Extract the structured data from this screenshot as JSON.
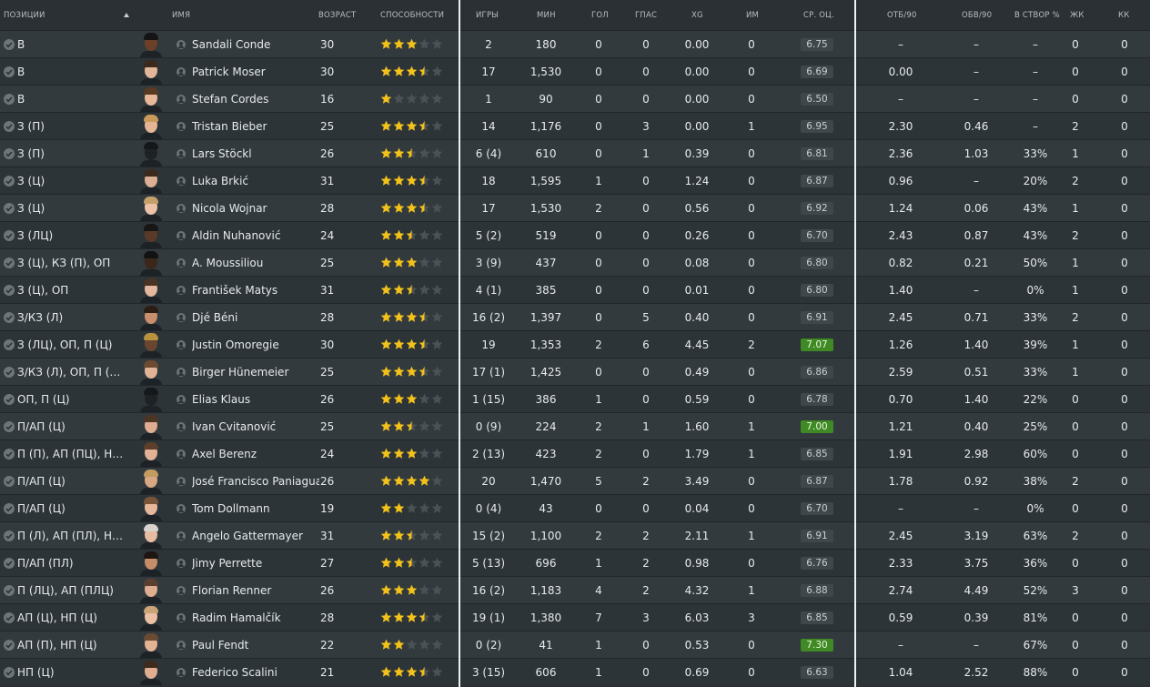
{
  "columns": {
    "positions": "ПОЗИЦИИ",
    "name": "ИМЯ",
    "age": "ВОЗРАСТ",
    "ability": "СПОСОБНОСТИ",
    "games": "ИГРЫ",
    "minutes": "МИН",
    "goals": "ГОЛ",
    "assists": "ГПАС",
    "xg": "XG",
    "mom": "ИМ",
    "avg_rating": "СР. ОЦ.",
    "tackles90": "ОТБ/90",
    "dribbles90": "ОБВ/90",
    "shots_on_target": "В СТВОР %",
    "yellow": "ЖК",
    "red": "КК"
  },
  "colors": {
    "star_gold": "#f2c21b",
    "star_empty": "#4a5256",
    "rating_high": "#3f8a24",
    "rating_default": "#3f474b"
  },
  "players": [
    {
      "pos": "В",
      "name": "Sandali Conde",
      "age": "30",
      "stars": 3,
      "games": "2",
      "min": "180",
      "goals": "0",
      "ast": "0",
      "xg": "0.00",
      "mom": "0",
      "rating": "6.75",
      "hi": false,
      "tck": "–",
      "drb": "–",
      "sot": "–",
      "yc": "0",
      "rc": "0",
      "skin": "#6b4026",
      "hair": "#141414"
    },
    {
      "pos": "В",
      "name": "Patrick Moser",
      "age": "30",
      "stars": 3.5,
      "games": "17",
      "min": "1,530",
      "goals": "0",
      "ast": "0",
      "xg": "0.00",
      "mom": "0",
      "rating": "6.69",
      "hi": false,
      "tck": "0.00",
      "drb": "–",
      "sot": "–",
      "yc": "0",
      "rc": "0",
      "skin": "#e3b69a",
      "hair": "#3a2a1e"
    },
    {
      "pos": "В",
      "name": "Stefan Cordes",
      "age": "16",
      "stars": 1,
      "games": "1",
      "min": "90",
      "goals": "0",
      "ast": "0",
      "xg": "0.00",
      "mom": "0",
      "rating": "6.50",
      "hi": false,
      "tck": "–",
      "drb": "–",
      "sot": "–",
      "yc": "0",
      "rc": "0",
      "skin": "#e8b899",
      "hair": "#5a3b22"
    },
    {
      "pos": "З (П)",
      "name": "Tristan Bieber",
      "age": "25",
      "stars": 3.5,
      "games": "14",
      "min": "1,176",
      "goals": "0",
      "ast": "3",
      "xg": "0.00",
      "mom": "1",
      "rating": "6.95",
      "hi": false,
      "tck": "2.30",
      "drb": "0.46",
      "sot": "–",
      "yc": "2",
      "rc": "0",
      "skin": "#e6b596",
      "hair": "#c99a5a"
    },
    {
      "pos": "З (П)",
      "name": "Lars Stöckl",
      "age": "26",
      "stars": 2.5,
      "games": "6 (4)",
      "min": "610",
      "goals": "0",
      "ast": "1",
      "xg": "0.39",
      "mom": "0",
      "rating": "6.81",
      "hi": false,
      "tck": "2.36",
      "drb": "1.03",
      "sot": "33%",
      "yc": "1",
      "rc": "0",
      "skin": "#1e2225",
      "hair": "#15181a"
    },
    {
      "pos": "З (Ц)",
      "name": "Luka Brkić",
      "age": "31",
      "stars": 3.5,
      "games": "18",
      "min": "1,595",
      "goals": "1",
      "ast": "0",
      "xg": "1.24",
      "mom": "0",
      "rating": "6.87",
      "hi": false,
      "tck": "0.96",
      "drb": "–",
      "sot": "20%",
      "yc": "2",
      "rc": "0",
      "skin": "#dcae94",
      "hair": "#3b2a1e"
    },
    {
      "pos": "З (Ц)",
      "name": "Nicola Wojnar",
      "age": "28",
      "stars": 3.5,
      "games": "17",
      "min": "1,530",
      "goals": "2",
      "ast": "0",
      "xg": "0.56",
      "mom": "0",
      "rating": "6.92",
      "hi": false,
      "tck": "1.24",
      "drb": "0.06",
      "sot": "43%",
      "yc": "1",
      "rc": "0",
      "skin": "#ecc3a6",
      "hair": "#c4a06a"
    },
    {
      "pos": "З (ЛЦ)",
      "name": "Aldin Nuhanović",
      "age": "24",
      "stars": 2.5,
      "games": "5 (2)",
      "min": "519",
      "goals": "0",
      "ast": "0",
      "xg": "0.26",
      "mom": "0",
      "rating": "6.70",
      "hi": false,
      "tck": "2.43",
      "drb": "0.87",
      "sot": "43%",
      "yc": "2",
      "rc": "0",
      "skin": "#5a3a26",
      "hair": "#161616"
    },
    {
      "pos": "З (Ц), КЗ (П), ОП",
      "name": "A. Moussiliou",
      "age": "25",
      "stars": 3,
      "games": "3 (9)",
      "min": "437",
      "goals": "0",
      "ast": "0",
      "xg": "0.08",
      "mom": "0",
      "rating": "6.80",
      "hi": false,
      "tck": "0.82",
      "drb": "0.21",
      "sot": "50%",
      "yc": "1",
      "rc": "0",
      "skin": "#3b261a",
      "hair": "#121212"
    },
    {
      "pos": "З (Ц), ОП",
      "name": "František Matys",
      "age": "31",
      "stars": 2.5,
      "games": "4 (1)",
      "min": "385",
      "goals": "0",
      "ast": "0",
      "xg": "0.01",
      "mom": "0",
      "rating": "6.80",
      "hi": false,
      "tck": "1.40",
      "drb": "–",
      "sot": "0%",
      "yc": "1",
      "rc": "0",
      "skin": "#e4b89e",
      "hair": "#4a3322"
    },
    {
      "pos": "З/КЗ (Л)",
      "name": "Djé Béni",
      "age": "28",
      "stars": 3.5,
      "games": "16 (2)",
      "min": "1,397",
      "goals": "0",
      "ast": "5",
      "xg": "0.40",
      "mom": "0",
      "rating": "6.91",
      "hi": false,
      "tck": "2.45",
      "drb": "0.71",
      "sot": "33%",
      "yc": "2",
      "rc": "0",
      "skin": "#c98e6c",
      "hair": "#2b1d14"
    },
    {
      "pos": "З (ЛЦ), ОП, П (Ц)",
      "name": "Justin Omoregie",
      "age": "30",
      "stars": 3.5,
      "games": "19",
      "min": "1,353",
      "goals": "2",
      "ast": "6",
      "xg": "4.45",
      "mom": "2",
      "rating": "7.07",
      "hi": true,
      "tck": "1.26",
      "drb": "1.40",
      "sot": "39%",
      "yc": "1",
      "rc": "0",
      "skin": "#6a4630",
      "hair": "#b8923c"
    },
    {
      "pos": "З/КЗ (Л), ОП, П (Ц), А...",
      "name": "Birger Hünemeier",
      "age": "25",
      "stars": 3.5,
      "games": "17 (1)",
      "min": "1,425",
      "goals": "0",
      "ast": "0",
      "xg": "0.49",
      "mom": "0",
      "rating": "6.86",
      "hi": false,
      "tck": "2.59",
      "drb": "0.51",
      "sot": "33%",
      "yc": "1",
      "rc": "0",
      "skin": "#e2b397",
      "hair": "#6b4a30"
    },
    {
      "pos": "ОП, П (Ц)",
      "name": "Elias Klaus",
      "age": "26",
      "stars": 3,
      "games": "1 (15)",
      "min": "386",
      "goals": "1",
      "ast": "0",
      "xg": "0.59",
      "mom": "0",
      "rating": "6.78",
      "hi": false,
      "tck": "0.70",
      "drb": "1.40",
      "sot": "22%",
      "yc": "0",
      "rc": "0",
      "skin": "#1e2225",
      "hair": "#15181a"
    },
    {
      "pos": "П/АП (Ц)",
      "name": "Ivan Cvitanović",
      "age": "25",
      "stars": 2.5,
      "games": "0 (9)",
      "min": "224",
      "goals": "2",
      "ast": "1",
      "xg": "1.60",
      "mom": "1",
      "rating": "7.00",
      "hi": true,
      "tck": "1.21",
      "drb": "0.40",
      "sot": "25%",
      "yc": "0",
      "rc": "0",
      "skin": "#dfae92",
      "hair": "#4d3526"
    },
    {
      "pos": "П (П), АП (ПЦ), НП (Ц)",
      "name": "Axel Berenz",
      "age": "24",
      "stars": 3,
      "games": "2 (13)",
      "min": "423",
      "goals": "2",
      "ast": "0",
      "xg": "1.79",
      "mom": "1",
      "rating": "6.85",
      "hi": false,
      "tck": "1.91",
      "drb": "2.98",
      "sot": "60%",
      "yc": "0",
      "rc": "0",
      "skin": "#e2b196",
      "hair": "#5b3f2a"
    },
    {
      "pos": "П/АП (Ц)",
      "name": "José Francisco Paniagua",
      "age": "26",
      "stars": 4,
      "games": "20",
      "min": "1,470",
      "goals": "5",
      "ast": "2",
      "xg": "3.49",
      "mom": "0",
      "rating": "6.87",
      "hi": false,
      "tck": "1.78",
      "drb": "0.92",
      "sot": "38%",
      "yc": "2",
      "rc": "0",
      "skin": "#d8a884",
      "hair": "#c29a62"
    },
    {
      "pos": "П/АП (Ц)",
      "name": "Tom Dollmann",
      "age": "19",
      "stars": 2,
      "games": "0 (4)",
      "min": "43",
      "goals": "0",
      "ast": "0",
      "xg": "0.04",
      "mom": "0",
      "rating": "6.70",
      "hi": false,
      "tck": "–",
      "drb": "–",
      "sot": "0%",
      "yc": "0",
      "rc": "0",
      "skin": "#e6b79a",
      "hair": "#7a5436"
    },
    {
      "pos": "П (Л), АП (ПЛ), НП (Ц)",
      "name": "Angelo Gattermayer",
      "age": "31",
      "stars": 2.5,
      "games": "15 (2)",
      "min": "1,100",
      "goals": "2",
      "ast": "2",
      "xg": "2.11",
      "mom": "1",
      "rating": "6.91",
      "hi": false,
      "tck": "2.45",
      "drb": "3.19",
      "sot": "63%",
      "yc": "2",
      "rc": "0",
      "skin": "#e8bca2",
      "hair": "#d9d2cc"
    },
    {
      "pos": "П/АП (ПЛ)",
      "name": "Jimy Perrette",
      "age": "27",
      "stars": 2.5,
      "games": "5 (13)",
      "min": "696",
      "goals": "1",
      "ast": "2",
      "xg": "0.98",
      "mom": "0",
      "rating": "6.76",
      "hi": false,
      "tck": "2.33",
      "drb": "3.75",
      "sot": "36%",
      "yc": "0",
      "rc": "0",
      "skin": "#c58d6a",
      "hair": "#1e1612"
    },
    {
      "pos": "П (ЛЦ), АП (ПЛЦ)",
      "name": "Florian Renner",
      "age": "26",
      "stars": 3,
      "games": "16 (2)",
      "min": "1,183",
      "goals": "4",
      "ast": "2",
      "xg": "4.32",
      "mom": "1",
      "rating": "6.88",
      "hi": false,
      "tck": "2.74",
      "drb": "4.49",
      "sot": "52%",
      "yc": "3",
      "rc": "0",
      "skin": "#dfad90",
      "hair": "#5a4030"
    },
    {
      "pos": "АП (Ц), НП (Ц)",
      "name": "Radim Hamalčík",
      "age": "28",
      "stars": 3.5,
      "games": "19 (1)",
      "min": "1,380",
      "goals": "7",
      "ast": "3",
      "xg": "6.03",
      "mom": "3",
      "rating": "6.85",
      "hi": false,
      "tck": "0.59",
      "drb": "0.39",
      "sot": "81%",
      "yc": "0",
      "rc": "0",
      "skin": "#ecc0a4",
      "hair": "#c9a476"
    },
    {
      "pos": "АП (П), НП (Ц)",
      "name": "Paul Fendt",
      "age": "22",
      "stars": 2,
      "games": "0 (2)",
      "min": "41",
      "goals": "1",
      "ast": "0",
      "xg": "0.53",
      "mom": "0",
      "rating": "7.30",
      "hi": true,
      "tck": "–",
      "drb": "–",
      "sot": "67%",
      "yc": "0",
      "rc": "0",
      "skin": "#e3b395",
      "hair": "#6b4a32"
    },
    {
      "pos": "НП (Ц)",
      "name": "Federico Scalini",
      "age": "21",
      "stars": 3.5,
      "games": "3 (15)",
      "min": "606",
      "goals": "1",
      "ast": "0",
      "xg": "0.69",
      "mom": "0",
      "rating": "6.63",
      "hi": false,
      "tck": "1.04",
      "drb": "2.52",
      "sot": "88%",
      "yc": "0",
      "rc": "0",
      "skin": "#dfae90",
      "hair": "#3e2b1e"
    }
  ]
}
